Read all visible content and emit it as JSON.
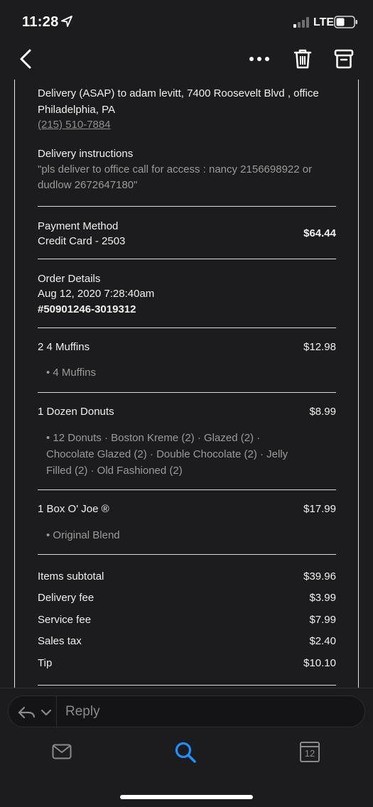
{
  "status_bar": {
    "time": "11:28",
    "network": "LTE"
  },
  "toolbar": {
    "back_icon": "chevron-left-icon",
    "more_icon": "more-icon",
    "trash_icon": "trash-icon",
    "archive_icon": "archive-icon"
  },
  "delivery": {
    "address_line1": "Delivery (ASAP) to adam levitt, 7400 Roosevelt Blvd , office",
    "address_line2": "Philadelphia, PA",
    "phone": "(215) 510-7884",
    "instructions_label": "Delivery instructions",
    "instructions_line1": "\"pls deliver to office call for access : nancy 2156698922 or",
    "instructions_line2": "dudlow 2672647180\""
  },
  "payment": {
    "label": "Payment Method",
    "method": "Credit Card - 2503",
    "total": "$64.44"
  },
  "order": {
    "label": "Order Details",
    "date": "Aug 12, 2020 7:28:40am",
    "number": "#50901246-3019312"
  },
  "items": [
    {
      "name": "2 4 Muffins",
      "price": "$12.98",
      "detail_lines": [
        "• 4 Muffins"
      ]
    },
    {
      "name": "1 Dozen Donuts",
      "price": "$8.99",
      "detail_lines": [
        "• 12 Donuts · Boston Kreme (2) · Glazed (2) ·",
        "Chocolate Glazed (2) · Double Chocolate (2) · Jelly",
        "Filled (2) · Old Fashioned (2)"
      ]
    },
    {
      "name": "1 Box O' Joe ®",
      "price": "$17.99",
      "detail_lines": [
        "• Original Blend"
      ]
    }
  ],
  "summary": [
    {
      "label": "Items subtotal",
      "value": "$39.96"
    },
    {
      "label": "Delivery fee",
      "value": "$3.99"
    },
    {
      "label": "Service fee",
      "value": "$7.99"
    },
    {
      "label": "Sales tax",
      "value": "$2.40"
    },
    {
      "label": "Tip",
      "value": "$10.10"
    }
  ],
  "reply": {
    "label": "Reply"
  },
  "tabs": {
    "mail_icon": "mail-icon",
    "search_icon": "search-icon",
    "calendar_icon": "calendar-icon",
    "calendar_day": "12"
  },
  "colors": {
    "background": "#1c1c1e",
    "accent": "#1e90ff",
    "text": "#f2f2f2",
    "muted": "#9a9a9a"
  }
}
